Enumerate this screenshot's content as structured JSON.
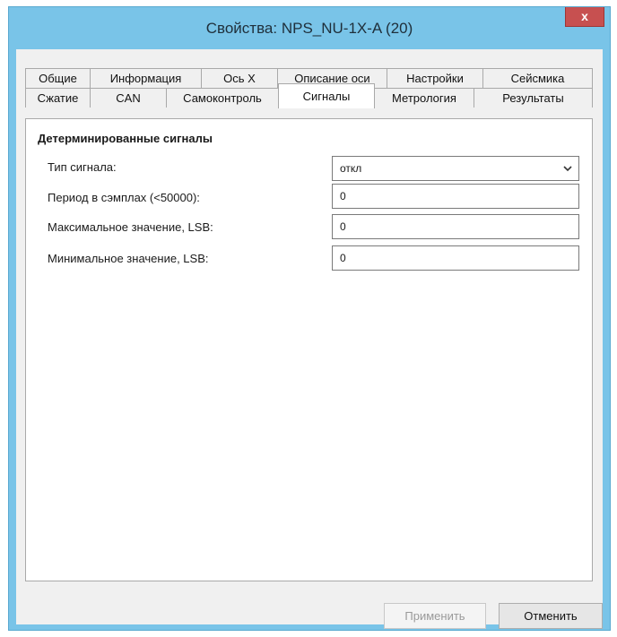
{
  "window": {
    "title": "Свойства: NPS_NU-1X-A (20)",
    "close_label": "x"
  },
  "tabs": {
    "row1": [
      "Общие",
      "Информация",
      "Ось X",
      "Описание оси",
      "Настройки",
      "Сейсмика"
    ],
    "row2": [
      "Сжатие",
      "CAN",
      "Самоконтроль",
      "Сигналы",
      "Метрология",
      "Результаты"
    ],
    "active": "Сигналы"
  },
  "section": {
    "title": "Детерминированные сигналы",
    "fields": [
      {
        "label": "Тип сигнала:",
        "value": "откл",
        "kind": "select"
      },
      {
        "label": "Период в сэмплах (<50000):",
        "value": "0",
        "kind": "input"
      },
      {
        "label": "Максимальное значение, LSB:",
        "value": "0",
        "kind": "input"
      },
      {
        "label": "Минимальное значение, LSB:",
        "value": "0",
        "kind": "input"
      }
    ]
  },
  "buttons": {
    "apply": "Применить",
    "cancel": "Отменить"
  },
  "icons": {
    "dropdown": "chevron-down-icon"
  }
}
